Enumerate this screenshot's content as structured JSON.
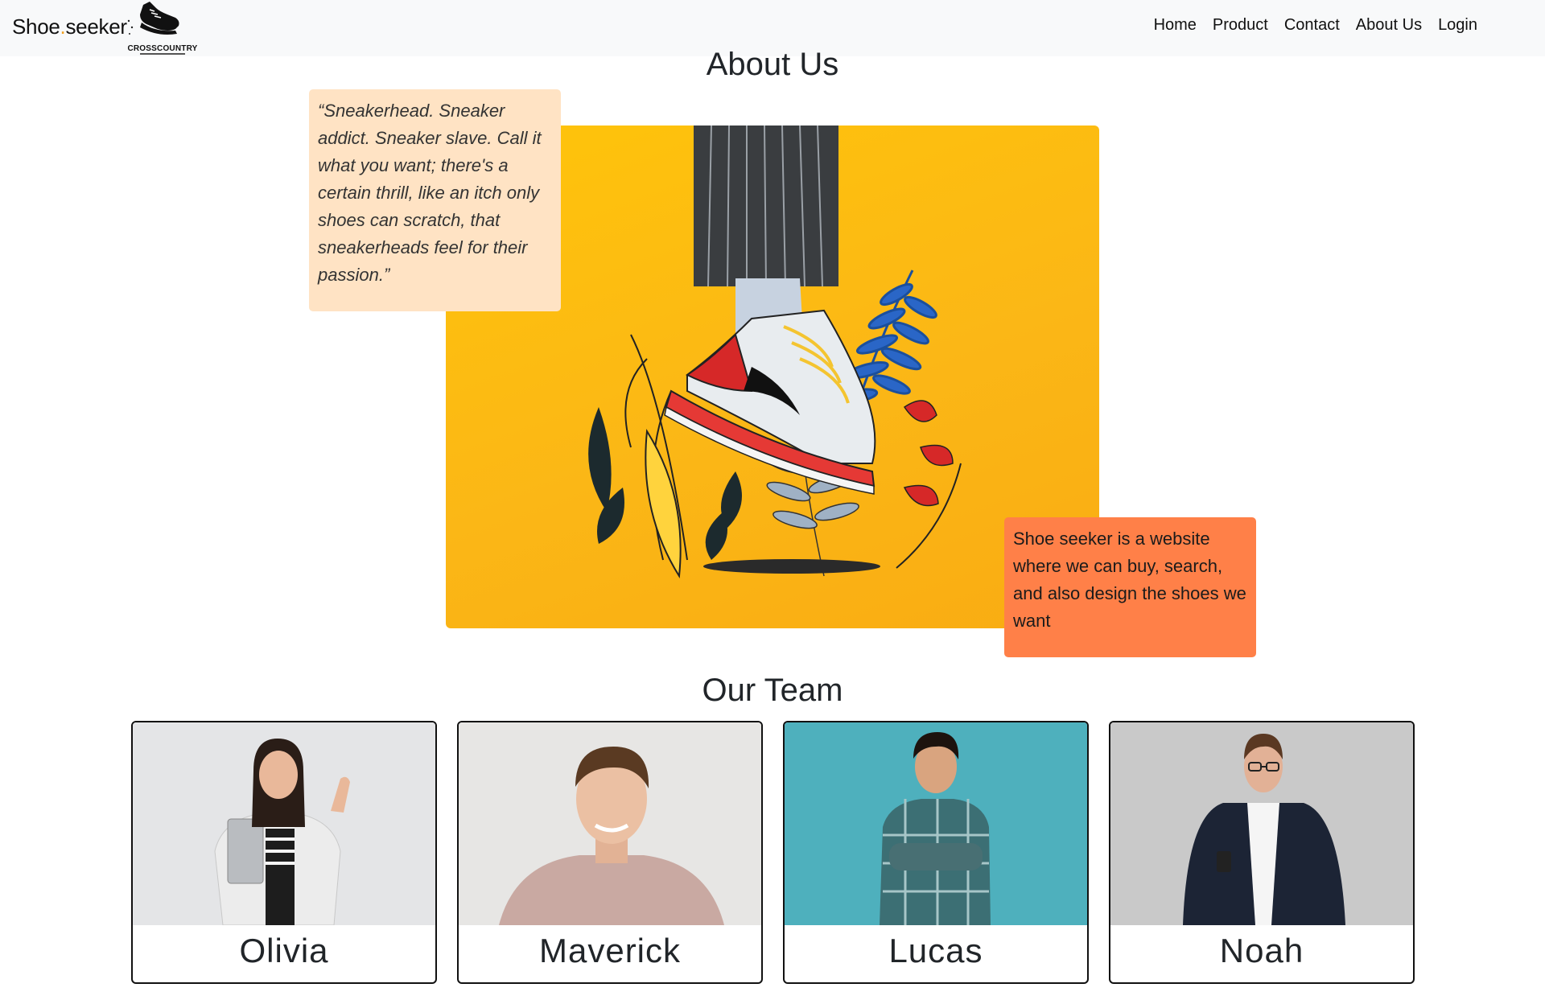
{
  "navbar": {
    "brand_part1": "Shoe",
    "brand_dot": ".",
    "brand_part2": "seeker",
    "logo_text": "CROSSCOUNTRY",
    "links": [
      "Home",
      "Product",
      "Contact",
      "About Us",
      "Login"
    ]
  },
  "about": {
    "title": "About Us",
    "quote": "“Sneakerhead. Sneaker addict. Sneaker slave. Call it what you want; there's a certain thrill, like an itch only shoes can scratch, that sneakerheads feel for their passion.”",
    "description": "Shoe seeker is a website where we can buy, search, and also design the shoes we want"
  },
  "team": {
    "title": "Our Team",
    "members": [
      {
        "name": "Olivia",
        "photo_bg": "#e4e5e7"
      },
      {
        "name": "Maverick",
        "photo_bg": "#e7e6e4"
      },
      {
        "name": "Lucas",
        "photo_bg": "#4eb0bd"
      },
      {
        "name": "Noah",
        "photo_bg": "#c9c9c9"
      }
    ]
  },
  "colors": {
    "navbar_bg": "#f8f9fa",
    "quote_bg": "#ffe3c4",
    "info_bg": "#ff8048",
    "hero_bg": "#fbb716"
  }
}
